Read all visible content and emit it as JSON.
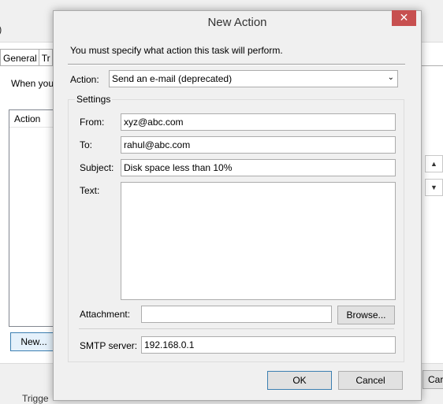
{
  "background_window": {
    "close_glyph": ")",
    "tabs": [
      {
        "label": "General"
      },
      {
        "label": "Tr"
      }
    ],
    "when_text": "When you",
    "list_header": "Action",
    "new_button": "New...",
    "cancel_partial": "Car",
    "triggers_partial": "Trigge",
    "scroll_up_glyph": "▲",
    "scroll_down_glyph": "▼"
  },
  "dialog": {
    "title": "New Action",
    "close_glyph": "✕",
    "prompt": "You must specify what action this task will perform.",
    "action_label": "Action:",
    "action_value": "Send an e-mail (deprecated)",
    "action_caret": "⌄",
    "settings_legend": "Settings",
    "from_label": "From:",
    "from_value": "xyz@abc.com",
    "to_label": "To:",
    "to_value": "rahul@abc.com",
    "subject_label": "Subject:",
    "subject_value": "Disk space less than 10%",
    "text_label": "Text:",
    "text_value": "",
    "attachment_label": "Attachment:",
    "attachment_value": "",
    "browse_button": "Browse...",
    "smtp_label": "SMTP server:",
    "smtp_value": "192.168.0.1",
    "ok_button": "OK",
    "cancel_button": "Cancel"
  },
  "colors": {
    "close_red": "#c75050",
    "default_button_border": "#3c7fb1",
    "dialog_bg": "#f0f0f0"
  }
}
